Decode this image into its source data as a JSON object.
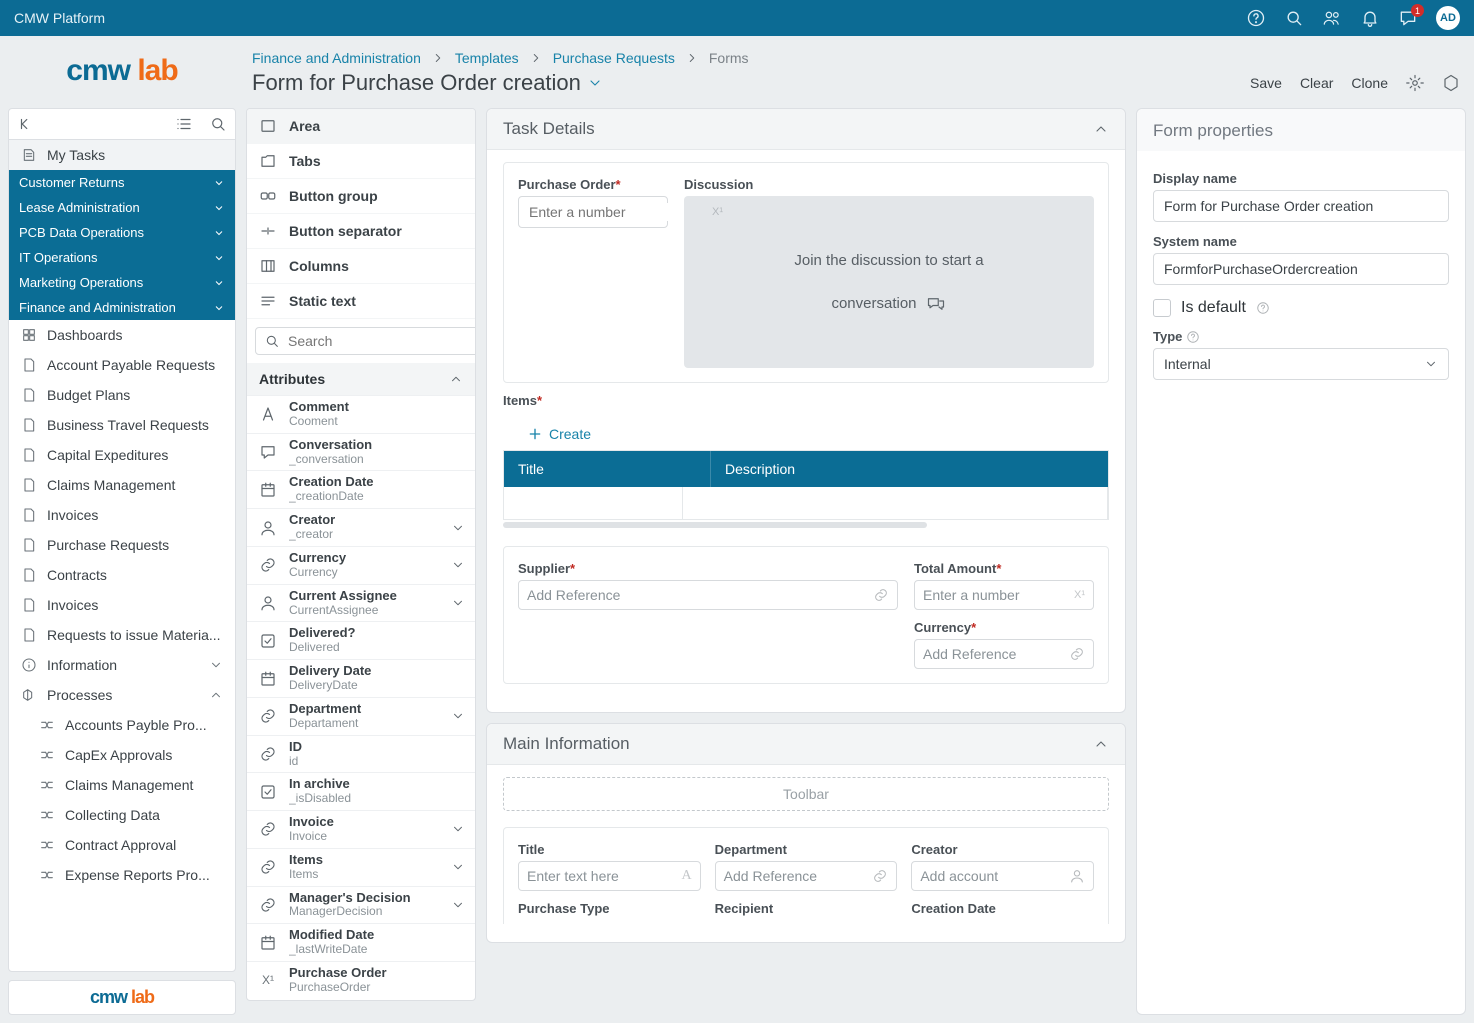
{
  "topbar": {
    "title": "CMW Platform",
    "avatar": "AD",
    "notif_count": "1"
  },
  "logo": {
    "a": "cmw",
    "b": " lab"
  },
  "breadcrumbs": [
    "Finance and Administration",
    "Templates",
    "Purchase Requests",
    "Forms"
  ],
  "page_title": "Form for Purchase Order creation",
  "page_actions": {
    "save": "Save",
    "clear": "Clear",
    "clone": "Clone"
  },
  "sidebar": {
    "my_tasks": "My Tasks",
    "categories": [
      "Customer Returns",
      "Lease Administration",
      "PCB Data Operations",
      "IT Operations",
      "Marketing Operations",
      "Finance and Administration"
    ],
    "items": [
      "Dashboards",
      "Account Payable Requests",
      "Budget Plans",
      "Business Travel Requests",
      "Capital Expeditures",
      "Claims Management",
      "Invoices",
      "Purchase Requests",
      "Contracts",
      "Invoices",
      "Requests to issue Materia..."
    ],
    "information": "Information",
    "processes": "Processes",
    "process_items": [
      "Accounts Payble Pro...",
      "CapEx Approvals",
      "Claims Management",
      "Collecting Data",
      "Contract Approval",
      "Expense Reports Pro..."
    ]
  },
  "elements": {
    "items": [
      "Area",
      "Tabs",
      "Button group",
      "Button separator",
      "Columns",
      "Static text"
    ],
    "search_placeholder": "Search",
    "attributes_header": "Attributes",
    "attributes": [
      {
        "icon": "text",
        "n1": "Comment",
        "n2": "Cooment",
        "chev": false
      },
      {
        "icon": "chat",
        "n1": "Conversation",
        "n2": "_conversation",
        "chev": false
      },
      {
        "icon": "date",
        "n1": "Creation Date",
        "n2": "_creationDate",
        "chev": false
      },
      {
        "icon": "user",
        "n1": "Creator",
        "n2": "_creator",
        "chev": true
      },
      {
        "icon": "link",
        "n1": "Currency",
        "n2": "Currency",
        "chev": true
      },
      {
        "icon": "user",
        "n1": "Current Assignee",
        "n2": "CurrentAssignee",
        "chev": true
      },
      {
        "icon": "check",
        "n1": "Delivered?",
        "n2": "Delivered",
        "chev": false
      },
      {
        "icon": "date",
        "n1": "Delivery Date",
        "n2": "DeliveryDate",
        "chev": false
      },
      {
        "icon": "link",
        "n1": "Department",
        "n2": "Departament",
        "chev": true
      },
      {
        "icon": "link",
        "n1": "ID",
        "n2": "id",
        "chev": false
      },
      {
        "icon": "check",
        "n1": "In archive",
        "n2": "_isDisabled",
        "chev": false
      },
      {
        "icon": "link",
        "n1": "Invoice",
        "n2": "Invoice",
        "chev": true
      },
      {
        "icon": "link",
        "n1": "Items",
        "n2": "Items",
        "chev": true
      },
      {
        "icon": "link",
        "n1": "Manager's Decision",
        "n2": "ManagerDecision",
        "chev": true
      },
      {
        "icon": "date",
        "n1": "Modified Date",
        "n2": "_lastWriteDate",
        "chev": false
      },
      {
        "icon": "num",
        "n1": "Purchase Order",
        "n2": "PurchaseOrder",
        "chev": false
      }
    ]
  },
  "canvas": {
    "task_details": {
      "title": "Task Details",
      "po_label": "Purchase Order",
      "po_placeholder": "Enter a number",
      "discussion_label": "Discussion",
      "discussion_text_1": "Join the discussion to start a",
      "discussion_text_2": "conversation",
      "items_label": "Items",
      "create_label": "Create",
      "th_title": "Title",
      "th_desc": "Description",
      "supplier_label": "Supplier",
      "add_reference": "Add Reference",
      "total_amount_label": "Total Amount",
      "enter_number": "Enter a number",
      "currency_label": "Currency"
    },
    "main_info": {
      "title": "Main Information",
      "toolbar": "Toolbar",
      "col_title": "Title",
      "col_department": "Department",
      "col_creator": "Creator",
      "title_placeholder": "Enter text here",
      "add_reference": "Add Reference",
      "add_account": "Add account",
      "col_purchase_type": "Purchase Type",
      "col_recipient": "Recipient",
      "col_creation_date": "Creation Date"
    }
  },
  "form_props": {
    "title": "Form properties",
    "display_name_label": "Display name",
    "display_name": "Form for Purchase Order creation",
    "system_name_label": "System name",
    "system_name": "FormforPurchaseOrdercreation",
    "is_default": "Is default",
    "type_label": "Type",
    "type_value": "Internal"
  }
}
